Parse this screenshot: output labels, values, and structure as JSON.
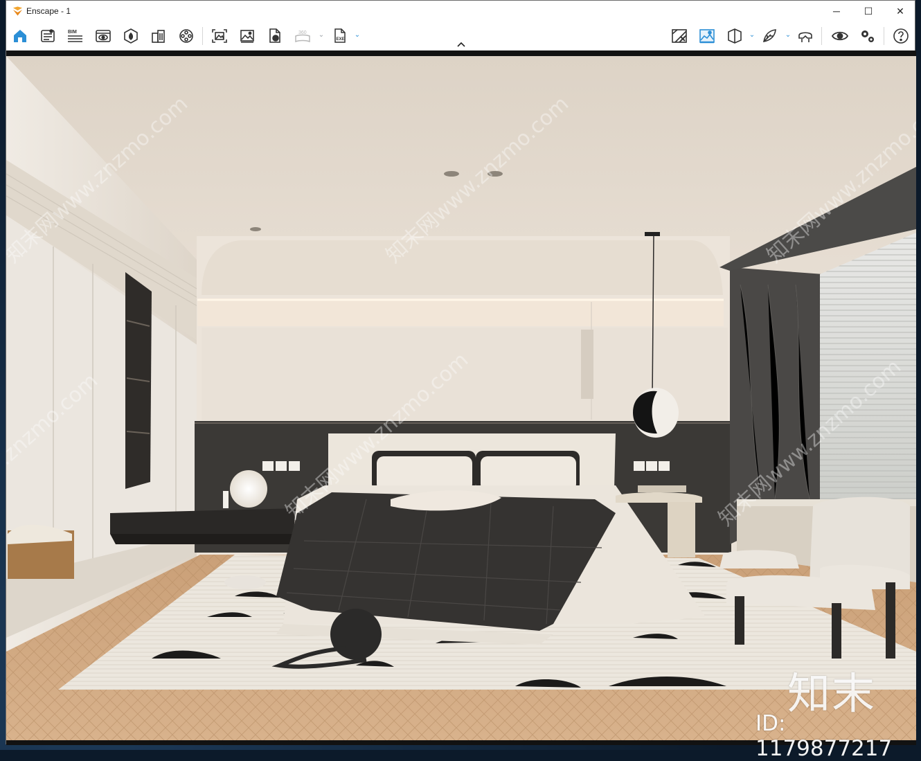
{
  "window": {
    "title": "Enscape - 1",
    "controls": {
      "minimize": "─",
      "maximize": "☐",
      "close": "✕"
    }
  },
  "toolbar": {
    "left_tools": [
      {
        "name": "home-icon",
        "active": true
      },
      {
        "name": "settings-sheet-icon"
      },
      {
        "name": "bim-icon",
        "label": "BIM"
      },
      {
        "name": "view-management-icon"
      },
      {
        "name": "asset-library-icon"
      },
      {
        "name": "material-editor-icon"
      },
      {
        "name": "video-editor-icon"
      },
      {
        "name": "capture-view-icon"
      },
      {
        "name": "screenshot-icon"
      },
      {
        "name": "export-batch-icon"
      },
      {
        "name": "panorama-360-icon",
        "label": "360",
        "disabled": true
      },
      {
        "name": "export-exe-icon",
        "label": "EXE"
      }
    ],
    "right_tools": [
      {
        "name": "minimap-icon"
      },
      {
        "name": "atmosphere-icon",
        "active": true
      },
      {
        "name": "section-view-icon"
      },
      {
        "name": "material-icon"
      },
      {
        "name": "vr-headset-icon"
      },
      {
        "name": "visual-settings-icon"
      },
      {
        "name": "general-settings-icon"
      },
      {
        "name": "help-icon"
      }
    ],
    "accent_color": "#2c8fd6"
  },
  "viewport": {
    "scene": "bedroom rendering",
    "watermark_text": "知末网www.znzmo.com",
    "logo_text": "知末",
    "id_text": "ID: 1179877217"
  }
}
